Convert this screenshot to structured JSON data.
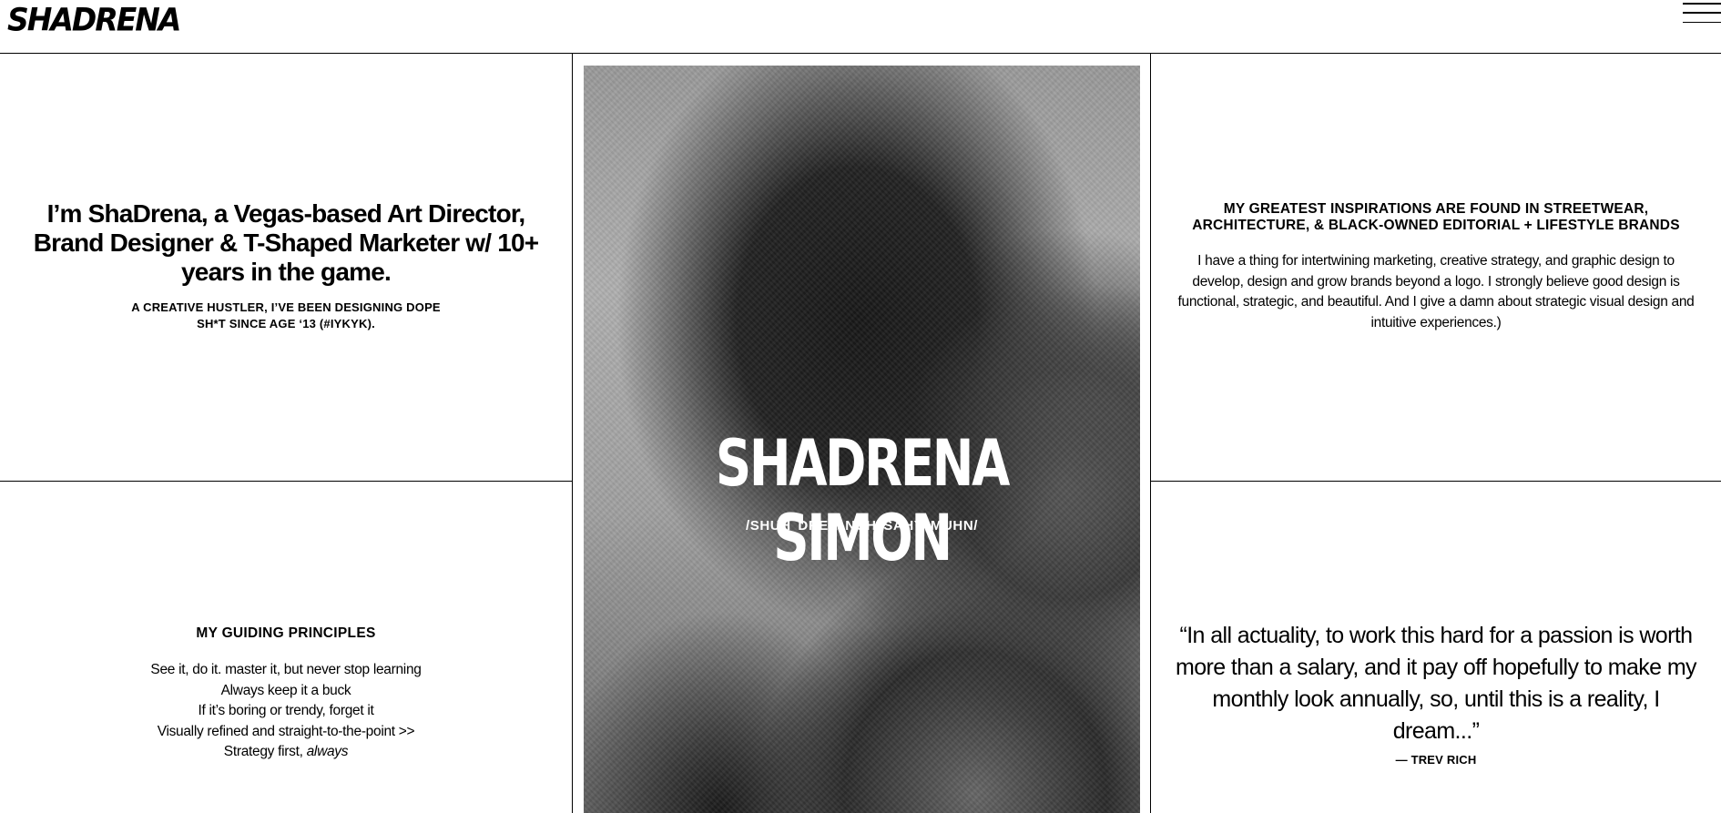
{
  "header": {
    "logo": "SHADRENA",
    "menu_icon": "hamburger-menu-icon"
  },
  "intro": {
    "headline": "I’m ShaDrena, a Vegas-based Art Director, Brand Designer & T-Shaped Marketer w/ 10+ years in the game.",
    "subline": "A CREATIVE HUSTLER, I’VE BEEN DESIGNING DOPE SH*T SINCE AGE ‘13 (#IYKYK)."
  },
  "hero": {
    "name": "SHADRENA SIMON",
    "phonetic": "/SHUH DREE NUH SAHY MUHN/"
  },
  "inspirations": {
    "title": "MY GREATEST INSPIRATIONS ARE FOUND IN STREETWEAR, ARCHITECTURE, & BLACK-OWNED EDITORIAL + LIFESTYLE BRANDS",
    "body": "I have a thing for intertwining marketing, creative strategy, and graphic design to develop, design and grow brands beyond a logo. I strongly believe good design is functional, strategic, and beautiful. And I give a damn about strategic visual design and intuitive experiences.)"
  },
  "principles": {
    "title": "MY GUIDING PRINCIPLES",
    "items": [
      "See it, do it.  master it, but never stop learning",
      "Always keep it a buck",
      "If it’s boring or trendy, forget it",
      "Visually refined and straight-to-the-point >>",
      "Strategy first, "
    ],
    "last_item_emphasis": "always"
  },
  "quote": {
    "text": "“In all actuality, to work this hard for a passion is worth more than a salary, and it pay off hopefully to make my monthly look annually, so, until this is a reality, I dream...”",
    "author": "— TREV RICH"
  }
}
